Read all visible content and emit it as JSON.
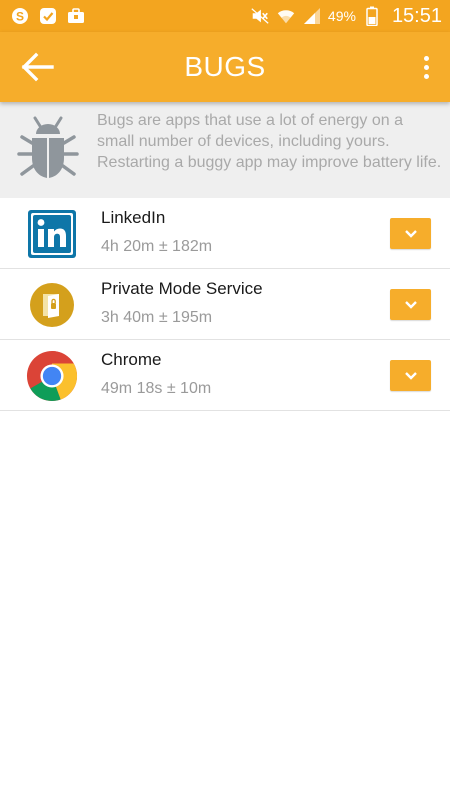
{
  "status_bar": {
    "battery_percent": "49%",
    "time": "15:51",
    "left_icons": [
      "skype-icon",
      "check-icon",
      "briefcase-icon"
    ],
    "right_icons": [
      "mute-icon",
      "wifi-icon",
      "signal-icon",
      "battery-icon"
    ]
  },
  "app_bar": {
    "title": "BUGS",
    "back_icon": "arrow-left-icon",
    "menu_icon": "more-vertical-icon"
  },
  "info": {
    "icon": "bug-icon",
    "text": "Bugs are apps that use a lot of energy on a small number of devices, including yours. Restarting a buggy app may improve battery life."
  },
  "apps": [
    {
      "name": "LinkedIn",
      "detail": "4h 20m ± 182m",
      "icon": "linkedin-icon"
    },
    {
      "name": "Private Mode Service",
      "detail": "3h 40m ± 195m",
      "icon": "private-mode-icon"
    },
    {
      "name": "Chrome",
      "detail": "49m 18s ± 10m",
      "icon": "chrome-icon"
    }
  ],
  "colors": {
    "status_bar": "#f3a51f",
    "accent": "#f6ad2b",
    "banner_bg": "#efefef",
    "bug_icon": "#8f969c"
  }
}
